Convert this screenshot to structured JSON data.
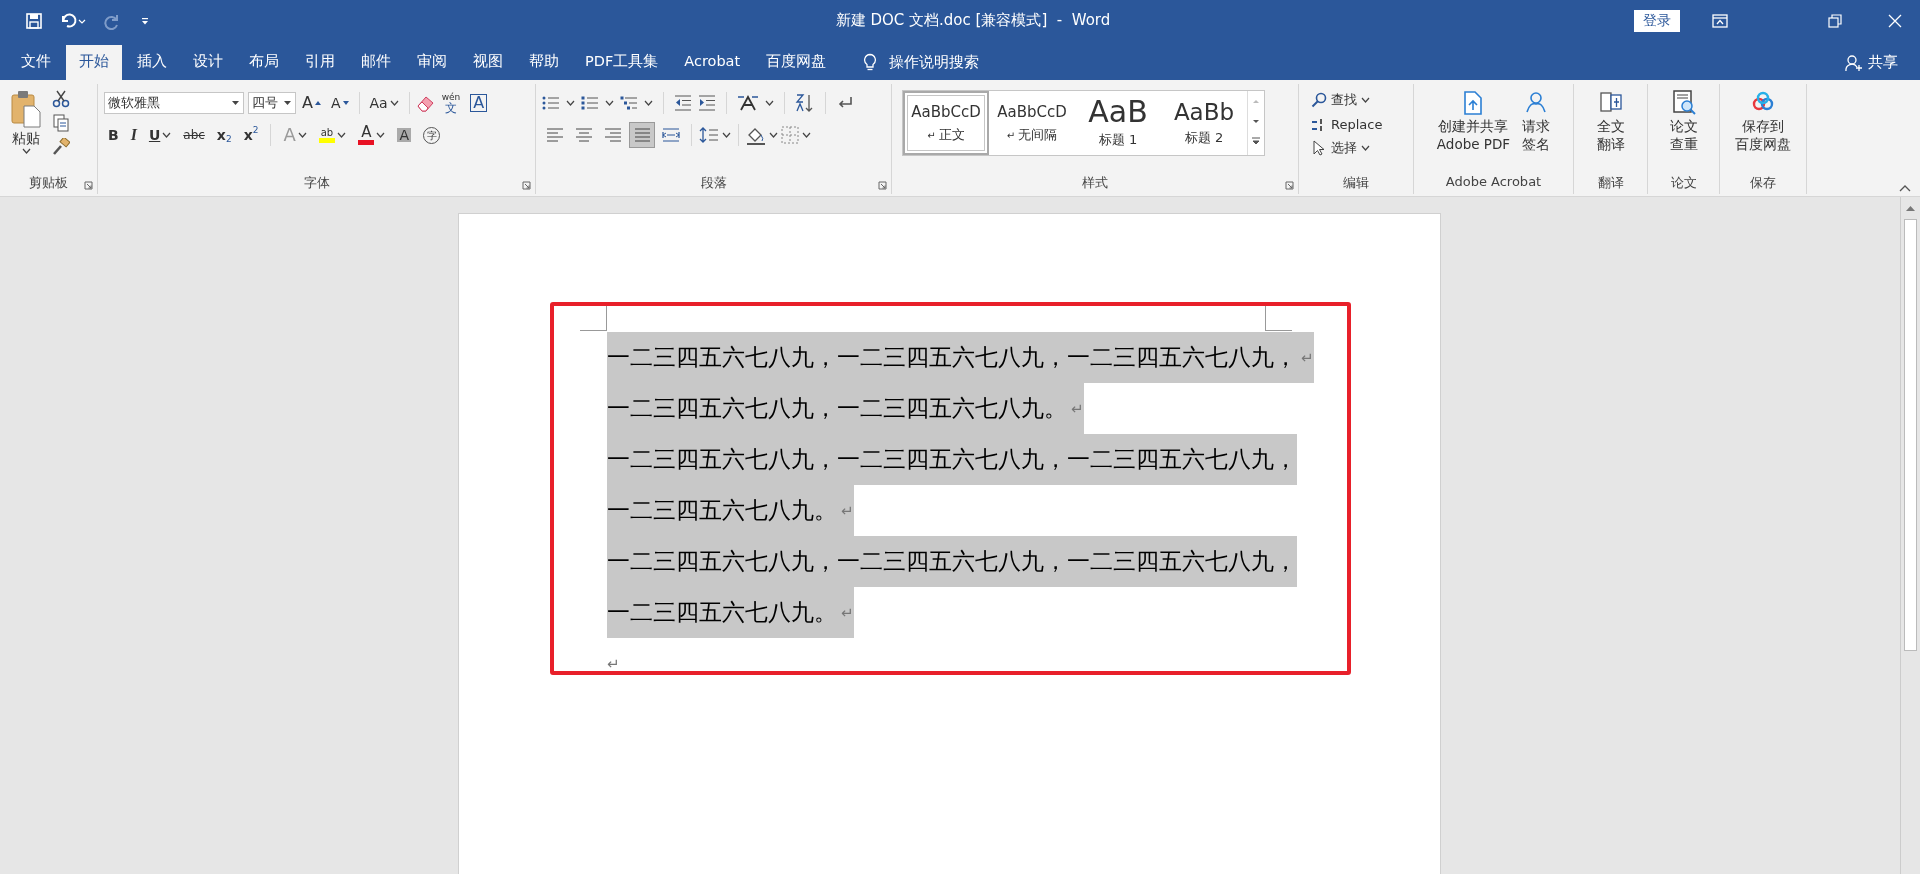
{
  "quick_access": [
    {
      "kind": "save",
      "disabled": false
    },
    {
      "kind": "undo",
      "disabled": false
    },
    {
      "kind": "redo",
      "disabled": true
    },
    {
      "kind": "customize",
      "disabled": false
    }
  ],
  "window": {
    "title": "新建 DOC 文档.doc [兼容模式]  -  Word",
    "sign_in": "登录"
  },
  "tabs": [
    {
      "label": "文件",
      "selected": false
    },
    {
      "label": "开始",
      "selected": true
    },
    {
      "label": "插入",
      "selected": false
    },
    {
      "label": "设计",
      "selected": false
    },
    {
      "label": "布局",
      "selected": false
    },
    {
      "label": "引用",
      "selected": false
    },
    {
      "label": "邮件",
      "selected": false
    },
    {
      "label": "审阅",
      "selected": false
    },
    {
      "label": "视图",
      "selected": false
    },
    {
      "label": "帮助",
      "selected": false
    },
    {
      "label": "PDF工具集",
      "selected": false
    },
    {
      "label": "Acrobat",
      "selected": false
    },
    {
      "label": "百度网盘",
      "selected": false
    }
  ],
  "tell_me": "操作说明搜索",
  "share": "共享",
  "clipboard": {
    "paste": "粘贴",
    "label": "剪贴板"
  },
  "font": {
    "name": "微软雅黑",
    "size": "四号",
    "label": "字体",
    "row1": [
      {
        "kind": "grow",
        "glyph": "A"
      },
      {
        "kind": "shrink",
        "glyph": "A"
      },
      {
        "kind": "case",
        "glyph": "Aa"
      },
      {
        "kind": "clear"
      },
      {
        "kind": "phonetic",
        "glyph": "文",
        "small": "wén"
      },
      {
        "kind": "border",
        "glyph": "A"
      }
    ],
    "row2": [
      {
        "kind": "bold",
        "glyph": "B"
      },
      {
        "kind": "italic",
        "glyph": "I"
      },
      {
        "kind": "underline",
        "glyph": "U"
      },
      {
        "kind": "strike",
        "glyph": "abc"
      },
      {
        "kind": "sub",
        "glyph": "x",
        "small": "2"
      },
      {
        "kind": "sup",
        "glyph": "x",
        "small": "2"
      },
      {
        "kind": "effects",
        "glyph": "A"
      },
      {
        "kind": "highlight",
        "glyph": "ab"
      },
      {
        "kind": "color",
        "glyph": "A"
      },
      {
        "kind": "shading",
        "glyph": "A"
      },
      {
        "kind": "enclose",
        "glyph": "字"
      }
    ]
  },
  "paragraph": {
    "label": "段落",
    "alignment": [
      {
        "kind": "left",
        "selected": false
      },
      {
        "kind": "center",
        "selected": false
      },
      {
        "kind": "right",
        "selected": false
      },
      {
        "kind": "justify",
        "selected": true
      },
      {
        "kind": "distributed",
        "selected": false
      }
    ]
  },
  "styles": {
    "label": "样式",
    "items": [
      {
        "preview": "AaBbCcD",
        "name": "正文",
        "mark": "↵",
        "selected": true
      },
      {
        "preview": "AaBbCcD",
        "name": "无间隔",
        "mark": "↵",
        "selected": false
      },
      {
        "preview": "AaB",
        "name": "标题 1",
        "selected": false
      },
      {
        "preview": "AaBb",
        "name": "标题 2",
        "selected": false
      }
    ]
  },
  "editing": {
    "label": "编辑",
    "items": [
      {
        "kind": "find",
        "text": "查找"
      },
      {
        "kind": "replace",
        "text": "Replace"
      },
      {
        "kind": "select",
        "text": "选择"
      }
    ]
  },
  "groups": [
    {
      "label": "Adobe Acrobat",
      "buttons": [
        {
          "kind": "pdf",
          "lines": [
            "创建并共享",
            "Adobe PDF"
          ]
        },
        {
          "kind": "sign",
          "lines": [
            "请求",
            "签名"
          ]
        }
      ]
    },
    {
      "label": "翻译",
      "buttons": [
        {
          "kind": "translate",
          "lines": [
            "全文",
            "翻译"
          ]
        }
      ]
    },
    {
      "label": "论文",
      "buttons": [
        {
          "kind": "check",
          "lines": [
            "论文",
            "查重"
          ]
        }
      ]
    },
    {
      "label": "保存",
      "buttons": [
        {
          "kind": "cloud",
          "lines": [
            "保存到",
            "百度网盘"
          ]
        }
      ]
    }
  ],
  "document": {
    "lines": [
      {
        "text": "一二三四五六七八九，一二三四五六七八九，一二三四五六七八九，",
        "mark": "↵",
        "selected": true
      },
      {
        "text": "一二三四五六七八九，一二三四五六七八九。",
        "mark": "↵",
        "selected": true
      },
      {
        "text": "一二三四五六七八九，一二三四五六七八九，一二三四五六七八九，",
        "selected": true
      },
      {
        "text": "一二三四五六七八九。",
        "mark": "↵",
        "selected": true
      },
      {
        "text": "一二三四五六七八九，一二三四五六七八九，一二三四五六七八九，",
        "selected": true
      },
      {
        "text": "一二三四五六七八九。",
        "mark": "↵",
        "selected": true
      },
      {
        "mark": "↵",
        "selected": false
      }
    ]
  }
}
